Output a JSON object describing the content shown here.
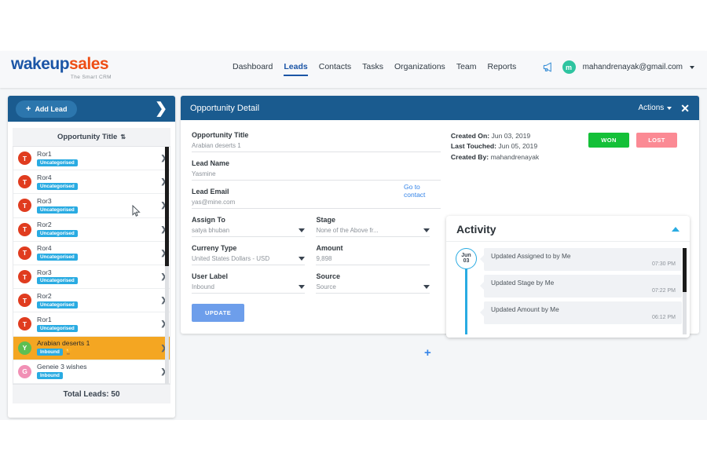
{
  "brand": {
    "name_part1": "wakeup",
    "name_part2": "sales",
    "tagline": "The Smart CRM"
  },
  "nav": {
    "items": [
      {
        "label": "Dashboard",
        "active": false
      },
      {
        "label": "Leads",
        "active": true
      },
      {
        "label": "Contacts",
        "active": false
      },
      {
        "label": "Tasks",
        "active": false
      },
      {
        "label": "Organizations",
        "active": false
      },
      {
        "label": "Team",
        "active": false
      },
      {
        "label": "Reports",
        "active": false
      }
    ]
  },
  "user": {
    "avatar_letter": "m",
    "email": "mahandrenayak@gmail.com",
    "announce_icon": "megaphone-icon"
  },
  "sidebar": {
    "add_lead_label": "Add Lead",
    "expand_icon": "chevron-right-icon",
    "list_header": "Opportunity Title",
    "sort_icon": "sort-updown-icon",
    "total_leads": "Total Leads: 50",
    "leads": [
      {
        "title": "Geneie 3 wishes",
        "badge": "Inbound",
        "initial": "G",
        "color": "#f190b5",
        "selected": false,
        "trophy": false
      },
      {
        "title": "Arabian deserts 1",
        "badge": "Inbound",
        "initial": "Y",
        "color": "#5cbf52",
        "selected": true,
        "trophy": true
      },
      {
        "title": "Ror1",
        "badge": "Uncategorised",
        "initial": "T",
        "color": "#e03c1f",
        "selected": false,
        "trophy": false
      },
      {
        "title": "Ror2",
        "badge": "Uncategorised",
        "initial": "T",
        "color": "#e03c1f",
        "selected": false,
        "trophy": false
      },
      {
        "title": "Ror3",
        "badge": "Uncategorised",
        "initial": "T",
        "color": "#e03c1f",
        "selected": false,
        "trophy": false
      },
      {
        "title": "Ror4",
        "badge": "Uncategorised",
        "initial": "T",
        "color": "#e03c1f",
        "selected": false,
        "trophy": false
      },
      {
        "title": "Ror2",
        "badge": "Uncategorised",
        "initial": "T",
        "color": "#e03c1f",
        "selected": false,
        "trophy": false
      },
      {
        "title": "Ror3",
        "badge": "Uncategorised",
        "initial": "T",
        "color": "#e03c1f",
        "selected": false,
        "trophy": false
      },
      {
        "title": "Ror4",
        "badge": "Uncategorised",
        "initial": "T",
        "color": "#e03c1f",
        "selected": false,
        "trophy": false
      },
      {
        "title": "Ror1",
        "badge": "Uncategorised",
        "initial": "T",
        "color": "#e03c1f",
        "selected": false,
        "trophy": false
      }
    ]
  },
  "detail": {
    "header_title": "Opportunity Detail",
    "actions_label": "Actions",
    "close_icon": "close-icon",
    "go_to_contact": "Go to contact",
    "update_label": "UPDATE",
    "add_field_icon": "plus-icon",
    "fields": [
      {
        "label": "Opportunity Title",
        "value": "Arabian deserts 1",
        "dropdown": false,
        "width": "full"
      },
      {
        "label": "Lead Name",
        "value": "Yasmine",
        "dropdown": false,
        "width": "full"
      },
      {
        "label": "Lead Email",
        "value": "yas@mine.com",
        "dropdown": false,
        "width": "full"
      },
      {
        "label": "Assign To",
        "value": "satya bhuban",
        "dropdown": true,
        "width": "half"
      },
      {
        "label": "Stage",
        "value": "None of the Above fr...",
        "dropdown": true,
        "width": "half"
      },
      {
        "label": "Curreny Type",
        "value": "United States Dollars - USD",
        "dropdown": true,
        "width": "half"
      },
      {
        "label": "Amount",
        "value": "9,898",
        "dropdown": false,
        "width": "half"
      },
      {
        "label": "User Label",
        "value": "Inbound",
        "dropdown": true,
        "width": "half"
      },
      {
        "label": "Source",
        "value": "Source",
        "dropdown": true,
        "width": "half"
      }
    ],
    "meta": [
      {
        "label": "Created On:",
        "value": "Jun 03, 2019"
      },
      {
        "label": "Last Touched:",
        "value": "Jun 05, 2019"
      },
      {
        "label": "Created By:",
        "value": "mahandrenayak"
      }
    ],
    "won_label": "WON",
    "lost_label": "LOST",
    "won_color": "#14c038",
    "lost_color": "#fb8a94"
  },
  "activity": {
    "title": "Activity",
    "collapse_icon": "chevron-up-icon",
    "date_month": "Jun",
    "date_day": "03",
    "items": [
      {
        "text": "Updated Assigned to by Me",
        "time": "07:30 PM"
      },
      {
        "text": "Updated Stage by Me",
        "time": "07:22 PM"
      },
      {
        "text": "Updated Amount by Me",
        "time": "06:12 PM"
      }
    ]
  },
  "theme": {
    "header_blue": "#1a5b8f",
    "accent_blue": "#29abe2",
    "selected_orange": "#f4a622",
    "update_blue": "#6d9eeb"
  }
}
